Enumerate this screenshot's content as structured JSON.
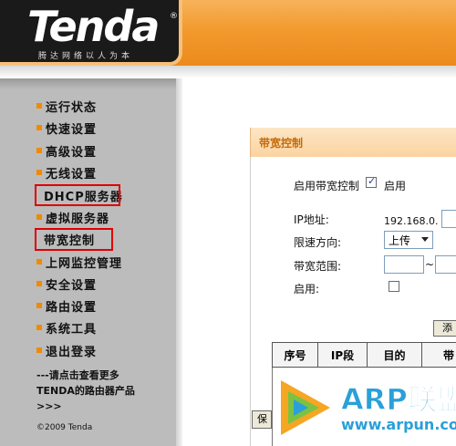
{
  "brand": {
    "logo_text": "Tenda",
    "registered": "®",
    "tagline": "腾达网络以人为本"
  },
  "sidebar": {
    "items": [
      {
        "label": "运行状态",
        "highlighted": false
      },
      {
        "label": "快速设置",
        "highlighted": false
      },
      {
        "label": "高级设置",
        "highlighted": false
      },
      {
        "label": "无线设置",
        "highlighted": false
      },
      {
        "label": "DHCP服务器",
        "highlighted": true
      },
      {
        "label": "虚拟服务器",
        "highlighted": false
      },
      {
        "label": "带宽控制",
        "highlighted": true
      },
      {
        "label": "上网监控管理",
        "highlighted": false
      },
      {
        "label": "安全设置",
        "highlighted": false
      },
      {
        "label": "路由设置",
        "highlighted": false
      },
      {
        "label": "系统工具",
        "highlighted": false
      },
      {
        "label": "退出登录",
        "highlighted": false
      }
    ],
    "more_line1": "---请点击查看更多",
    "more_line2": "TENDA的路由器产品",
    "more_line3": ">>>",
    "copyright": "©2009 Tenda"
  },
  "panel": {
    "title": "带宽控制",
    "enable_label": "启用带宽控制",
    "enable_checked": true,
    "enable_text": "启用",
    "ip_label": "IP地址:",
    "ip_prefix": "192.168.0.",
    "direction_label": "限速方向:",
    "direction_value": "上传",
    "range_label": "带宽范围:",
    "range_sep": "~",
    "enabled_label": "启用:",
    "enabled_checked": false,
    "add_button": "添",
    "save_button": "保"
  },
  "table": {
    "headers": [
      "序号",
      "IP段",
      "目的",
      "带"
    ]
  },
  "watermark": {
    "text": "ARP联盟",
    "url": "www.arpun.com"
  },
  "colors": {
    "accent_orange": "#f08a00",
    "highlight_red": "#e00000",
    "panel_title": "#c46a0a",
    "watermark_blue": "#2aa0d8"
  }
}
